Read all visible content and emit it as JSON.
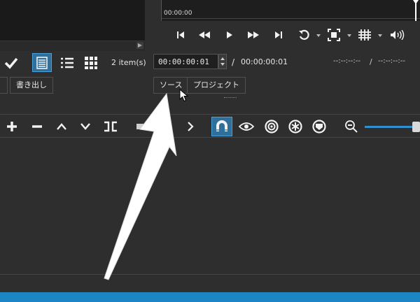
{
  "player": {
    "timecode_ruler": "00:00:00",
    "current_position": "00:00:00:01",
    "duration": "00:00:00:01",
    "separator": "/",
    "in_out_a": "--:--:--:--",
    "in_out_sep": "/",
    "in_out_b": "--:--:--:--"
  },
  "playlist": {
    "item_count": "2 item(s)"
  },
  "tabs": {
    "export_label": "書き出し",
    "source_label": "ソース",
    "project_label": "プロジェクト"
  },
  "timeline_icons": [
    "plus-icon",
    "minus-icon",
    "chevron-up-icon",
    "chevron-down-icon",
    "split-icon",
    "chevron-right-icon",
    "magnet-icon",
    "eye-icon",
    "target-icon",
    "asterisk-icon",
    "shield-icon",
    "zoom-out-icon"
  ],
  "colors": {
    "background": "#2e2e2e",
    "accent_blue": "#1c85c4",
    "active_button_bg": "#2f6f9a"
  }
}
